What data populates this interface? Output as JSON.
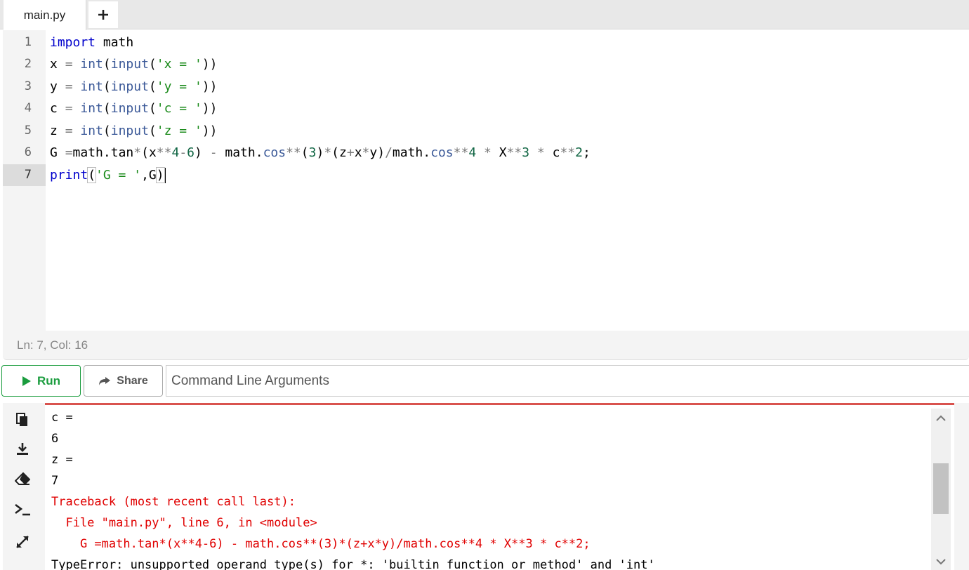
{
  "tabs": {
    "file_name": "main.py",
    "add_label": "+"
  },
  "editor": {
    "line_numbers": [
      "1",
      "2",
      "3",
      "4",
      "5",
      "6",
      "7"
    ],
    "active_line": 7
  },
  "status": {
    "text": "Ln: 7,  Col: 16"
  },
  "toolbar": {
    "run_label": "Run",
    "share_label": "Share",
    "args_placeholder": "Command Line Arguments"
  },
  "console": {
    "lines": [
      {
        "text": "c =",
        "type": "stdout"
      },
      {
        "text": "6",
        "type": "stdout"
      },
      {
        "text": "z =",
        "type": "stdout"
      },
      {
        "text": "7",
        "type": "stdout"
      },
      {
        "text": "Traceback (most recent call last):",
        "type": "error"
      },
      {
        "text": "  File \"main.py\", line 6, in <module>",
        "type": "error"
      },
      {
        "text": "    G =math.tan*(x**4-6) - math.cos**(3)*(z+x*y)/math.cos**4 * X**3 * c**2;",
        "type": "error"
      },
      {
        "text": "TypeError: unsupported operand type(s) for *: 'builtin function or method' and 'int'",
        "type": "stdout"
      }
    ]
  },
  "colors": {
    "run_green": "#1a9c3e",
    "error_red": "#e00000",
    "console_border": "#d9534f"
  },
  "icons": [
    "copy-icon",
    "download-icon",
    "eraser-icon",
    "terminal-icon",
    "expand-icon",
    "play-icon",
    "share-icon"
  ]
}
